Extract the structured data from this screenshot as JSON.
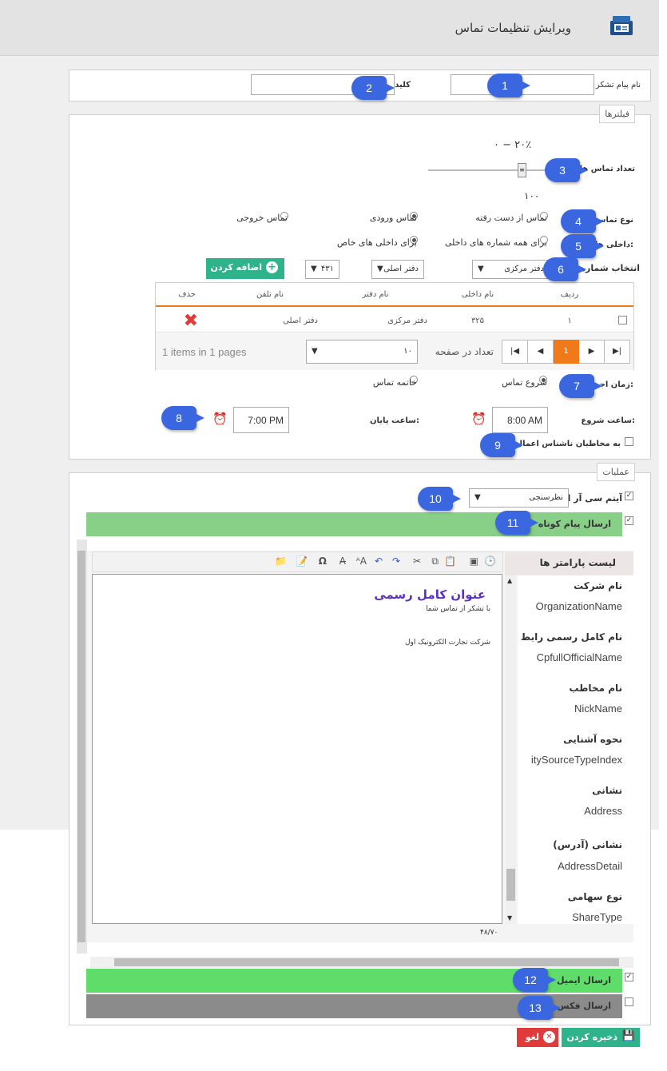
{
  "header": {
    "title": "ویرایش تنظیمات تماس"
  },
  "top": {
    "thank_msg_label": "نام پیام تشکر از تماس",
    "key_label": "کلید"
  },
  "filters": {
    "legend": "فیلترها",
    "range_text": "۰ − ۲۰٪",
    "count_label": "تعداد تماس ها",
    "count_value": "۱۰۰",
    "slider_percent": 20,
    "call_type_label": "نوع تماس",
    "call_types": [
      "تماس از دست رفته",
      "تماس ورودی",
      "تماس خروجی"
    ],
    "internals_label": "داخلی ها:",
    "internals": [
      "برای همه شماره های داخلی",
      "برای داخلی های خاص"
    ],
    "select_number_label": "انتخاب شماره",
    "office_select": "دفتر مرکزی",
    "main_office_select": "دفتر اصلی",
    "ext_select": "۴۳۱",
    "add_button": "اضافه کردن"
  },
  "table": {
    "headers": [
      "ردیف",
      "نام داخلی",
      "نام دفتر",
      "نام تلفن",
      "حذف"
    ],
    "rows": [
      {
        "row": "۱",
        "internal": "۳۲۵",
        "office": "دفتر مرکزی",
        "phone": "دفتر اصلی"
      }
    ],
    "page_current": "1",
    "per_page_label": "تعداد در صفحه",
    "per_page_value": "۱۰",
    "items_info": "1 items in 1 pages"
  },
  "schedule": {
    "run_time_label": "زمان اجرا:",
    "options": [
      "شروع تماس",
      "خاتمه تماس"
    ],
    "start_label": "ساعت شروع:",
    "start_value": "8:00 AM",
    "end_label": "ساعت پایان:",
    "end_value": "7:00 PM",
    "anon_label": "به مخاطبان ناشناس اعمال شود"
  },
  "operations": {
    "legend": "عملیات",
    "crm_label": "آیتم سی آر ام",
    "crm_select": "نظرسنجی",
    "sms_label": "ارسال پیام کوتاه",
    "email_label": "ارسال ایمیل",
    "fax_label": "ارسال فکس"
  },
  "editor": {
    "heading": "عنوان کامل رسمی",
    "line1": "با تشکر از تماس شما",
    "line2": "شرکت تجارت الکترونیک اول",
    "counter": "۴۸/۷۰"
  },
  "params": {
    "title": "لیست پارامتر ها",
    "items": [
      {
        "label": "نام شرکت",
        "value": "OrganizationName"
      },
      {
        "label": "نام کامل رسمی رابط",
        "value": "CpfullOfficialName"
      },
      {
        "label": "نام مخاطب",
        "value": "NickName"
      },
      {
        "label": "نحوه آشنایی",
        "value": "itySourceTypeIndex"
      },
      {
        "label": "نشانی",
        "value": "Address"
      },
      {
        "label": "نشانی (آدرس)",
        "value": "AddressDetail"
      },
      {
        "label": "نوع سهامی",
        "value": "ShareType"
      }
    ]
  },
  "footer": {
    "save": "ذخیره کردن",
    "cancel": "لغو"
  },
  "badges": [
    "1",
    "2",
    "3",
    "4",
    "5",
    "6",
    "7",
    "8",
    "9",
    "10",
    "11",
    "12",
    "13"
  ],
  "colors": {
    "accent": "#3a66e0",
    "green": "#2fb38a",
    "orange": "#f07a1a",
    "red": "#e03a3a"
  }
}
